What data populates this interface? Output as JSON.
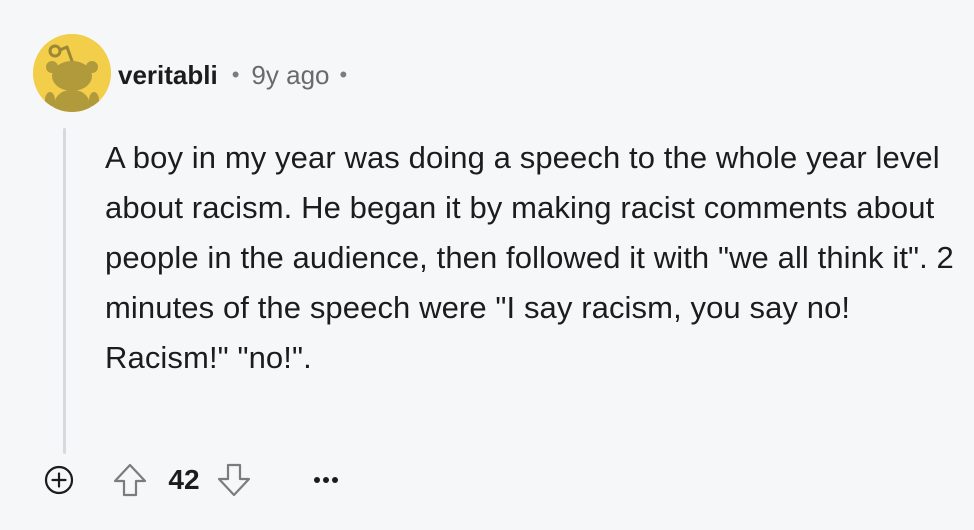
{
  "comment": {
    "username": "veritabli",
    "separator": "•",
    "timestamp": "9y ago",
    "body": "A boy in my year was doing a speech to the whole year level about racism. He began it by making racist comments about people in the audience, then followed it with \"we all think it\". 2 minutes of the speech were \"I say racism, you say no! Racism!\" \"no!\".",
    "score": "42"
  },
  "icons": {
    "avatar": "snoo-avatar",
    "expand": "plus-circle-icon",
    "upvote": "arrow-up-icon",
    "downvote": "arrow-down-icon",
    "more": "ellipsis-icon"
  },
  "colors": {
    "background": "#f6f7f8",
    "avatar_bg": "#f2ce4a",
    "snoo_body": "#b09a3c",
    "text": "#1c1c1c",
    "muted": "#6a6a6a",
    "thread_line": "#d6dadd"
  }
}
